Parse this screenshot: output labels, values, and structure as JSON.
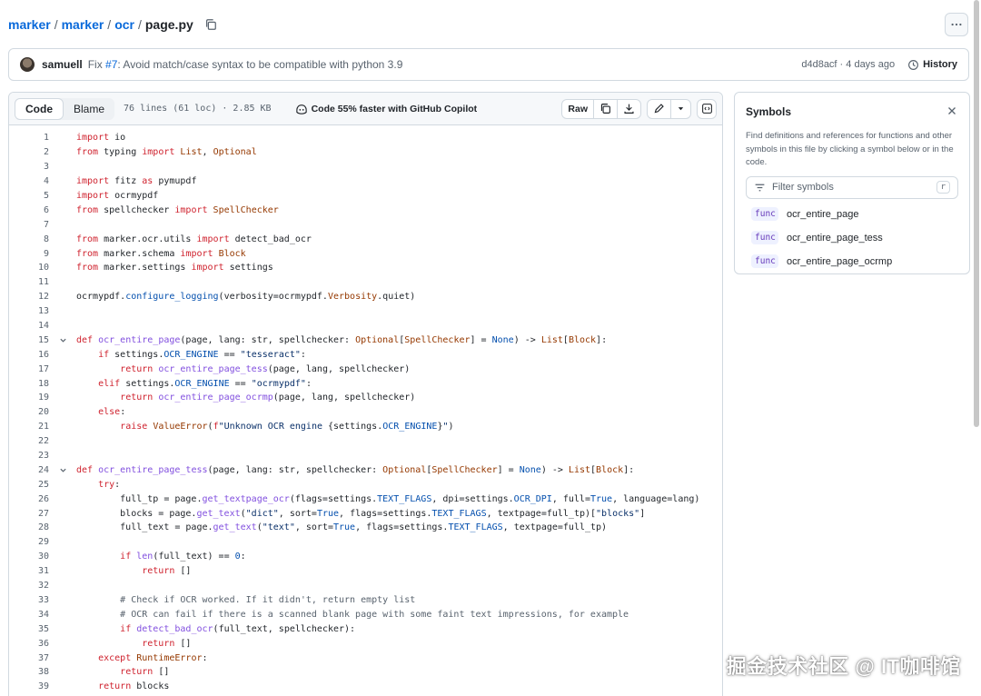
{
  "breadcrumb": {
    "repo_owner": "marker",
    "repo_name": "marker",
    "dir": "ocr",
    "file": "page.py"
  },
  "commit": {
    "author": "samuell",
    "message_prefix": "Fix ",
    "pr_ref": "#7",
    "message_rest": ": Avoid match/case syntax to be compatible with python 3.9",
    "sha": "d4d8acf",
    "time": " · 4 days ago",
    "history_label": "History"
  },
  "toolbar": {
    "code_tab": "Code",
    "blame_tab": "Blame",
    "meta": "76 lines (61 loc) · 2.85 KB",
    "copilot": "Code 55% faster with GitHub Copilot",
    "raw_label": "Raw"
  },
  "code_lines": [
    {
      "n": "1",
      "fold": false,
      "html": "<span class='k'>import</span> io"
    },
    {
      "n": "2",
      "fold": false,
      "html": "<span class='k'>from</span> typing <span class='k'>import</span> <span class='t'>List</span>, <span class='t'>Optional</span>"
    },
    {
      "n": "3",
      "fold": false,
      "html": ""
    },
    {
      "n": "4",
      "fold": false,
      "html": "<span class='k'>import</span> fitz <span class='k'>as</span> pymupdf"
    },
    {
      "n": "5",
      "fold": false,
      "html": "<span class='k'>import</span> ocrmypdf"
    },
    {
      "n": "6",
      "fold": false,
      "html": "<span class='k'>from</span> spellchecker <span class='k'>import</span> <span class='t'>SpellChecker</span>"
    },
    {
      "n": "7",
      "fold": false,
      "html": ""
    },
    {
      "n": "8",
      "fold": false,
      "html": "<span class='k'>from</span> marker.ocr.utils <span class='k'>import</span> detect_bad_ocr"
    },
    {
      "n": "9",
      "fold": false,
      "html": "<span class='k'>from</span> marker.schema <span class='k'>import</span> <span class='t'>Block</span>"
    },
    {
      "n": "10",
      "fold": false,
      "html": "<span class='k'>from</span> marker.settings <span class='k'>import</span> settings"
    },
    {
      "n": "11",
      "fold": false,
      "html": ""
    },
    {
      "n": "12",
      "fold": false,
      "html": "ocrmypdf.<span class='n'>configure_logging</span>(verbosity=ocrmypdf.<span class='t'>Verbosity</span>.quiet)"
    },
    {
      "n": "13",
      "fold": false,
      "html": ""
    },
    {
      "n": "14",
      "fold": false,
      "html": ""
    },
    {
      "n": "15",
      "fold": true,
      "html": "<span class='k'>def</span> <span class='f'>ocr_entire_page</span>(page, lang: str, spellchecker: <span class='t'>Optional</span>[<span class='t'>SpellChecker</span>] = <span class='n'>None</span>) -&gt; <span class='t'>List</span>[<span class='t'>Block</span>]:"
    },
    {
      "n": "16",
      "fold": false,
      "html": "    <span class='k'>if</span> settings.<span class='n'>OCR_ENGINE</span> == <span class='s'>\"tesseract\"</span>:"
    },
    {
      "n": "17",
      "fold": false,
      "html": "        <span class='k'>return</span> <span class='f'>ocr_entire_page_tess</span>(page, lang, spellchecker)"
    },
    {
      "n": "18",
      "fold": false,
      "html": "    <span class='k'>elif</span> settings.<span class='n'>OCR_ENGINE</span> == <span class='s'>\"ocrmypdf\"</span>:"
    },
    {
      "n": "19",
      "fold": false,
      "html": "        <span class='k'>return</span> <span class='f'>ocr_entire_page_ocrmp</span>(page, lang, spellchecker)"
    },
    {
      "n": "20",
      "fold": false,
      "html": "    <span class='k'>else</span>:"
    },
    {
      "n": "21",
      "fold": false,
      "html": "        <span class='k'>raise</span> <span class='t'>ValueError</span>(<span class='k'>f</span><span class='s'>\"Unknown OCR engine </span>{settings.<span class='n'>OCR_ENGINE</span>}<span class='s'>\"</span>)"
    },
    {
      "n": "22",
      "fold": false,
      "html": ""
    },
    {
      "n": "23",
      "fold": false,
      "html": ""
    },
    {
      "n": "24",
      "fold": true,
      "html": "<span class='k'>def</span> <span class='f'>ocr_entire_page_tess</span>(page, lang: str, spellchecker: <span class='t'>Optional</span>[<span class='t'>SpellChecker</span>] = <span class='n'>None</span>) -&gt; <span class='t'>List</span>[<span class='t'>Block</span>]:"
    },
    {
      "n": "25",
      "fold": false,
      "html": "    <span class='k'>try</span>:"
    },
    {
      "n": "26",
      "fold": false,
      "html": "        full_tp = page.<span class='f'>get_textpage_ocr</span>(flags=settings.<span class='n'>TEXT_FLAGS</span>, dpi=settings.<span class='n'>OCR_DPI</span>, full=<span class='n'>True</span>, language=lang)"
    },
    {
      "n": "27",
      "fold": false,
      "html": "        blocks = page.<span class='f'>get_text</span>(<span class='s'>\"dict\"</span>, sort=<span class='n'>True</span>, flags=settings.<span class='n'>TEXT_FLAGS</span>, textpage=full_tp)[<span class='s'>\"blocks\"</span>]"
    },
    {
      "n": "28",
      "fold": false,
      "html": "        full_text = page.<span class='f'>get_text</span>(<span class='s'>\"text\"</span>, sort=<span class='n'>True</span>, flags=settings.<span class='n'>TEXT_FLAGS</span>, textpage=full_tp)"
    },
    {
      "n": "29",
      "fold": false,
      "html": ""
    },
    {
      "n": "30",
      "fold": false,
      "html": "        <span class='k'>if</span> <span class='f'>len</span>(full_text) == <span class='n'>0</span>:"
    },
    {
      "n": "31",
      "fold": false,
      "html": "            <span class='k'>return</span> []"
    },
    {
      "n": "32",
      "fold": false,
      "html": ""
    },
    {
      "n": "33",
      "fold": false,
      "html": "        <span class='c'># Check if OCR worked. If it didn't, return empty list</span>"
    },
    {
      "n": "34",
      "fold": false,
      "html": "        <span class='c'># OCR can fail if there is a scanned blank page with some faint text impressions, for example</span>"
    },
    {
      "n": "35",
      "fold": false,
      "html": "        <span class='k'>if</span> <span class='f'>detect_bad_ocr</span>(full_text, spellchecker):"
    },
    {
      "n": "36",
      "fold": false,
      "html": "            <span class='k'>return</span> []"
    },
    {
      "n": "37",
      "fold": false,
      "html": "    <span class='k'>except</span> <span class='t'>RuntimeError</span>:"
    },
    {
      "n": "38",
      "fold": false,
      "html": "        <span class='k'>return</span> []"
    },
    {
      "n": "39",
      "fold": false,
      "html": "    <span class='k'>return</span> blocks"
    }
  ],
  "symbols": {
    "title": "Symbols",
    "description": "Find definitions and references for functions and other symbols in this file by clicking a symbol below or in the code.",
    "filter_placeholder": "Filter symbols",
    "filter_shortcut": "r",
    "items": [
      {
        "tag": "func",
        "name": "ocr_entire_page"
      },
      {
        "tag": "func",
        "name": "ocr_entire_page_tess"
      },
      {
        "tag": "func",
        "name": "ocr_entire_page_ocrmp"
      }
    ]
  },
  "watermark": "掘金技术社区 @ IT咖啡馆"
}
